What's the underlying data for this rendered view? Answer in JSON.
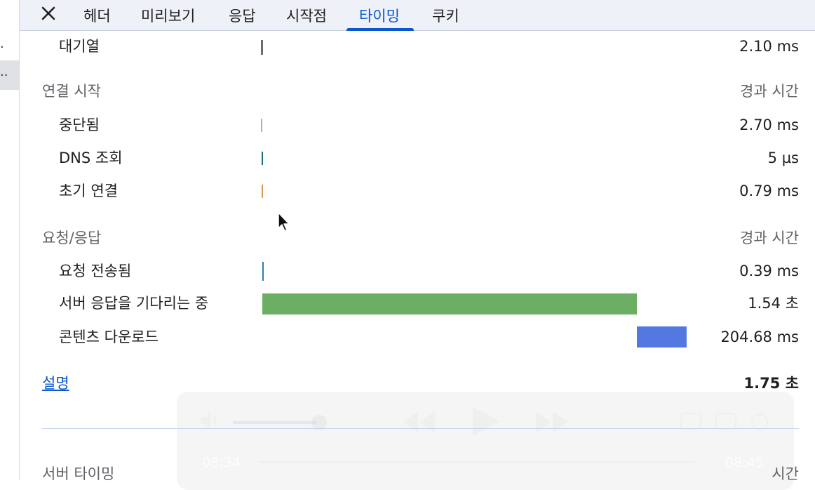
{
  "tabs": [
    {
      "label": "헤더",
      "active": false
    },
    {
      "label": "미리보기",
      "active": false
    },
    {
      "label": "응답",
      "active": false
    },
    {
      "label": "시작점",
      "active": false
    },
    {
      "label": "타이밍",
      "active": true
    },
    {
      "label": "쿠키",
      "active": false
    }
  ],
  "queue": {
    "label": "대기열",
    "value": "2.10 ms"
  },
  "connection": {
    "title": "연결 시작",
    "column": "경과 시간",
    "rows": [
      {
        "label": "중단됨",
        "value": "2.70 ms"
      },
      {
        "label": "DNS 조회",
        "value": "5 µs"
      },
      {
        "label": "초기 연결",
        "value": "0.79 ms"
      }
    ]
  },
  "request": {
    "title": "요청/응답",
    "column": "경과 시간",
    "rows": [
      {
        "label": "요청 전송됨",
        "value": "0.39 ms"
      },
      {
        "label": "서버 응답을 기다리는 중",
        "value": "1.54 초"
      },
      {
        "label": "콘텐츠 다운로드",
        "value": "204.68 ms"
      }
    ]
  },
  "explain_link": "설명",
  "total": "1.75 초",
  "server_timing": {
    "title": "서버 타이밍",
    "column": "시간"
  },
  "player": {
    "time_start": "08:34",
    "time_end": "08:45"
  },
  "colors": {
    "accent": "#0b57d0",
    "waiting_bar": "#6aaf63",
    "download_bar": "#5379e0",
    "queue_tick": "#6b6b6b",
    "stalled_tick": "#b0b0b0",
    "dns_tick": "#1e6e8a",
    "connect_tick": "#e0964a",
    "sent_tick": "#2a7fb0"
  }
}
